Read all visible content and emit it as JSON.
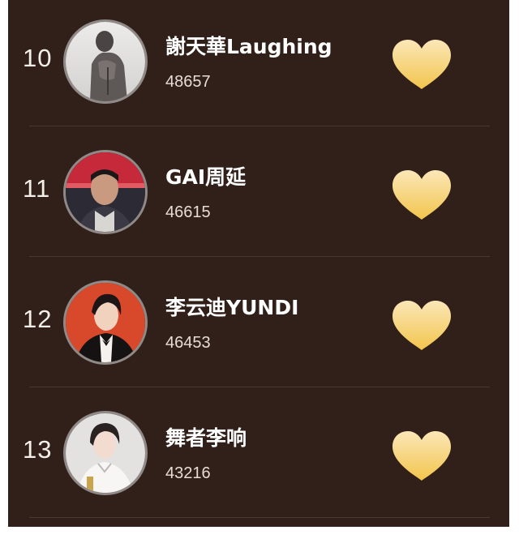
{
  "colors": {
    "background": "#312019",
    "divider": "#4a3830",
    "heart_top": "#fbe7b8",
    "heart_bottom": "#f2c54c"
  },
  "ranking": {
    "items": [
      {
        "rank": "10",
        "name": "謝天華Laughing",
        "score": "48657",
        "avatar": "avatar-photo",
        "like_icon": "heart-icon"
      },
      {
        "rank": "11",
        "name": "GAI周延",
        "score": "46615",
        "avatar": "avatar-photo",
        "like_icon": "heart-icon"
      },
      {
        "rank": "12",
        "name": "李云迪YUNDI",
        "score": "46453",
        "avatar": "avatar-photo",
        "like_icon": "heart-icon"
      },
      {
        "rank": "13",
        "name": "舞者李响",
        "score": "43216",
        "avatar": "avatar-photo",
        "like_icon": "heart-icon"
      }
    ]
  }
}
